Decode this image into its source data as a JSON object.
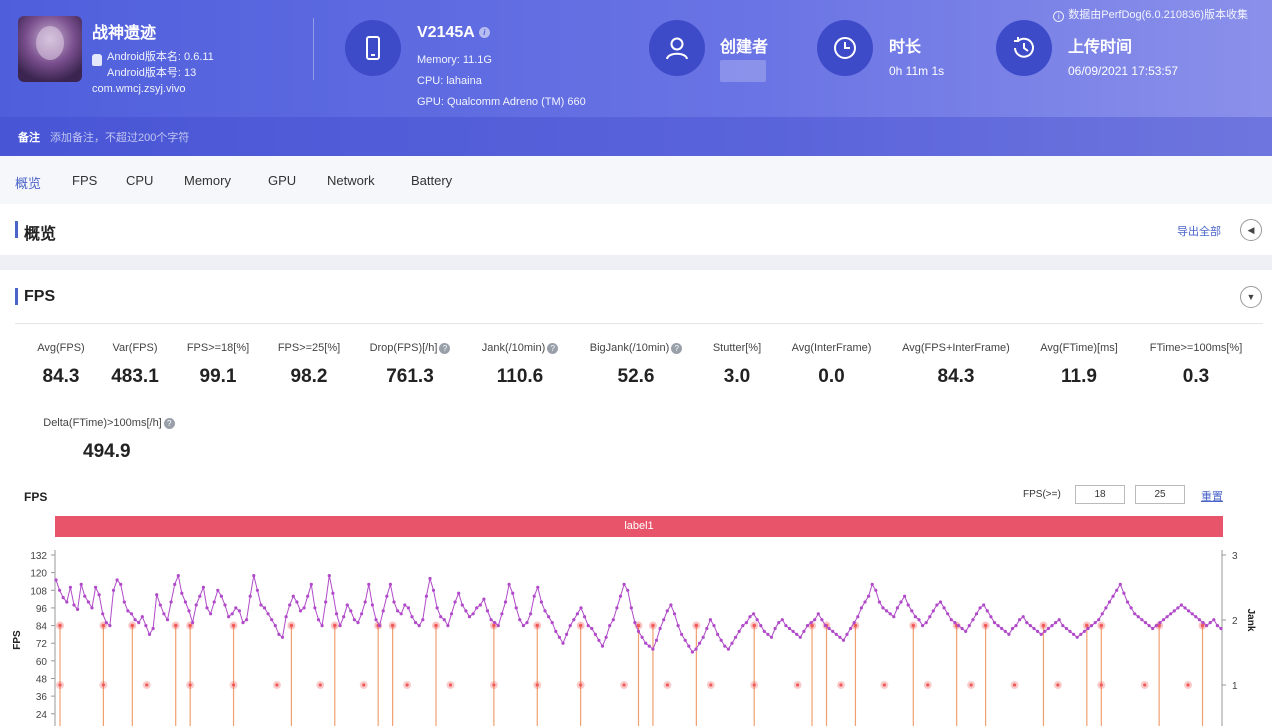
{
  "header": {
    "app_name": "战神遗迹",
    "android_version_name": "Android版本名: 0.6.11",
    "android_version_code": "Android版本号: 13",
    "package": "com.wmcj.zsyj.vivo",
    "device_model": "V2145A",
    "device_memory": "Memory: 11.1G",
    "device_cpu": "CPU: lahaina",
    "device_gpu": "GPU: Qualcomm Adreno (TM) 660",
    "creator_label": "创建者",
    "duration_label": "时长",
    "duration_value": "0h 11m 1s",
    "upload_label": "上传时间",
    "upload_value": "06/09/2021 17:53:57",
    "source_note": "数据由PerfDog(6.0.210836)版本收集",
    "note_label": "备注",
    "note_placeholder": "添加备注，不超过200个字符"
  },
  "tabs": [
    "概览",
    "FPS",
    "CPU",
    "Memory",
    "GPU",
    "Network",
    "Battery"
  ],
  "overview": {
    "title": "概览",
    "export_label": "导出全部"
  },
  "fps_section": {
    "title": "FPS",
    "stats": [
      {
        "label": "Avg(FPS)",
        "value": "84.3"
      },
      {
        "label": "Var(FPS)",
        "value": "483.1"
      },
      {
        "label": "FPS>=18[%]",
        "value": "99.1"
      },
      {
        "label": "FPS>=25[%]",
        "value": "98.2"
      },
      {
        "label": "Drop(FPS)[/h]",
        "value": "761.3"
      },
      {
        "label": "Jank(/10min)",
        "value": "110.6"
      },
      {
        "label": "BigJank(/10min)",
        "value": "52.6"
      },
      {
        "label": "Stutter[%]",
        "value": "3.0"
      },
      {
        "label": "Avg(InterFrame)",
        "value": "0.0"
      },
      {
        "label": "Avg(FPS+InterFrame)",
        "value": "84.3"
      },
      {
        "label": "Avg(FTime)[ms]",
        "value": "11.9"
      },
      {
        "label": "FTime>=100ms[%]",
        "value": "0.3"
      },
      {
        "label": "Delta(FTime)>100ms[/h]",
        "value": "494.9"
      }
    ],
    "chart_title": "FPS",
    "threshold_label": "FPS(>=)",
    "threshold_1": "18",
    "threshold_2": "25",
    "reset_label": "重置",
    "band_label": "label1"
  },
  "colors": {
    "accent": "#4a64c8",
    "header_start": "#4f5fdc",
    "header_end": "#8a90ea",
    "band": "#e8556a",
    "fps_line": "#b04ac8",
    "jank_line": "#f0a070",
    "bigjank_marker": "#f05a5a",
    "lower_line": "#6f86d8"
  },
  "chart_data": {
    "type": "line",
    "title": "FPS",
    "ylabel": "FPS",
    "y2label": "Jank",
    "ylim": [
      0,
      132
    ],
    "y_ticks": [
      24,
      36,
      48,
      60,
      72,
      84,
      96,
      108,
      120,
      132
    ],
    "y2_ticks": [
      1,
      2,
      3
    ],
    "series": [
      {
        "values": [
          115,
          108,
          103,
          100,
          110,
          98,
          95,
          112,
          104,
          100,
          96,
          110,
          105,
          92,
          86,
          84,
          108,
          115,
          112,
          100,
          94,
          92,
          88,
          86,
          90,
          84,
          78,
          82,
          105,
          98,
          92,
          88,
          100,
          112,
          118,
          106,
          100,
          94,
          86,
          98,
          104,
          110,
          96,
          92,
          100,
          108,
          104,
          98,
          90,
          92,
          96,
          94,
          86,
          88,
          104,
          118,
          108,
          98,
          96,
          92,
          88,
          84,
          78,
          76,
          90,
          98,
          104,
          100,
          94,
          96,
          104,
          112,
          96,
          88,
          84,
          100,
          118,
          106,
          92,
          84,
          90,
          98,
          94,
          88,
          86,
          92,
          100,
          112,
          98,
          88,
          84,
          94,
          104,
          112,
          100,
          94,
          92,
          98,
          96,
          90,
          86,
          84,
          88,
          104,
          116,
          108,
          96,
          90,
          88,
          84,
          92,
          100,
          106,
          98,
          94,
          90,
          92,
          96,
          98,
          102,
          94,
          88,
          86,
          84,
          92,
          100,
          112,
          106,
          96,
          88,
          84,
          86,
          92,
          104,
          110,
          100,
          94,
          90,
          86,
          80,
          76,
          72,
          78,
          84,
          88,
          92,
          96,
          90,
          84,
          82,
          78,
          74,
          70,
          76,
          84,
          88,
          96,
          104,
          112,
          108,
          96,
          86,
          80,
          76,
          72,
          70,
          68,
          74,
          82,
          88,
          94,
          98,
          92,
          84,
          78,
          74,
          70,
          66,
          68,
          72,
          76,
          82,
          88,
          84,
          78,
          74,
          70,
          68,
          72,
          76,
          80,
          84,
          86,
          90,
          92,
          88,
          84,
          80,
          78,
          76,
          82,
          86,
          88,
          84,
          82,
          80,
          78,
          76,
          80,
          84,
          86,
          88,
          92,
          88,
          84,
          82,
          80,
          78,
          76,
          74,
          78,
          82,
          86,
          90,
          96,
          100,
          104,
          112,
          108,
          100,
          96,
          94,
          92,
          90,
          96,
          100,
          104,
          98,
          94,
          90,
          88,
          84,
          86,
          90,
          94,
          98,
          100,
          96,
          92,
          88,
          86,
          84,
          82,
          80,
          84,
          88,
          92,
          96,
          98,
          94,
          90,
          86,
          84,
          82,
          80,
          78,
          82,
          84,
          88,
          90,
          86,
          84,
          82,
          80,
          78,
          80,
          82,
          84,
          86,
          88,
          84,
          82,
          80,
          78,
          76,
          78,
          80,
          82,
          84,
          86,
          88,
          92,
          96,
          100,
          104,
          108,
          112,
          106,
          100,
          96,
          92,
          90,
          88,
          86,
          84,
          82,
          84,
          86,
          88,
          90,
          92,
          94,
          96,
          98,
          96,
          94,
          92,
          90,
          88,
          86,
          84,
          86,
          88,
          84,
          82
        ]
      },
      {
        "values": [
          1.0,
          0.2,
          0.2,
          1.0,
          0.2,
          1.0,
          0.2,
          0.2,
          1.0,
          1.0,
          0.2,
          0.2,
          1.0,
          0.2,
          0.2,
          0.2,
          1.0,
          0.2,
          0.2,
          1.0,
          0.2,
          0.2,
          1.0,
          1.0,
          0.2,
          0.2,
          1.0,
          0.2,
          0.2,
          0.2,
          1.0,
          0.2,
          0.2,
          1.0,
          0.2,
          0.2,
          1.0,
          0.2,
          0.2,
          0.2,
          1.0,
          1.0,
          0.2,
          0.2,
          1.0,
          0.2,
          0.2,
          0.2,
          1.0,
          0.2,
          0.2,
          0.2,
          1.0,
          1.0,
          0.2,
          1.0,
          0.2,
          0.2,
          0.2,
          1.0,
          0.2,
          0.2,
          1.0,
          0.2,
          1.0,
          0.2,
          0.2,
          0.2,
          1.0,
          0.2,
          0.2,
          1.0,
          1.0,
          0.2,
          0.2,
          0.2,
          1.0,
          0.2,
          0.2,
          1.0,
          0.2
        ]
      }
    ]
  }
}
